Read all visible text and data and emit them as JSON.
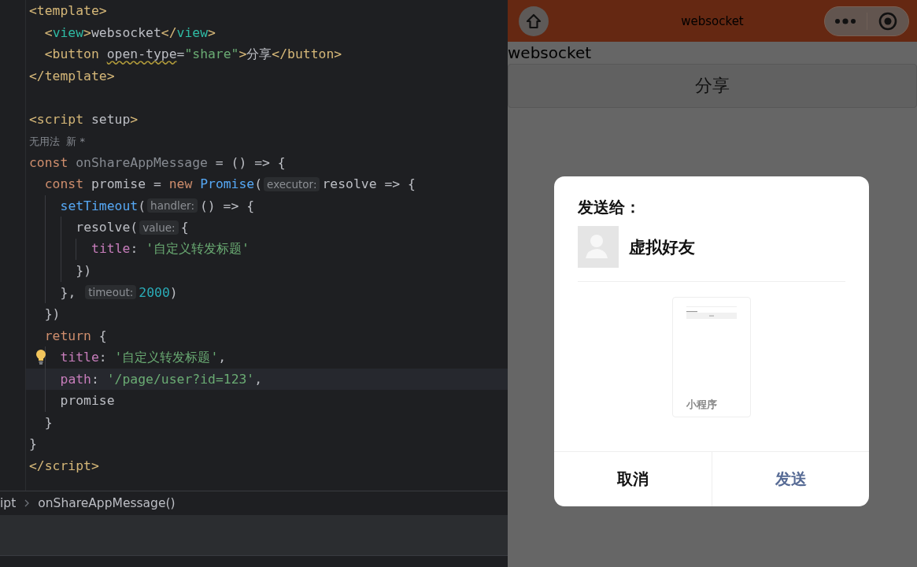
{
  "editor": {
    "lines": [
      {
        "current": false,
        "tokens": [
          {
            "kind": "tag",
            "text": "<template>"
          }
        ]
      },
      {
        "current": false,
        "tokens": [
          {
            "kind": "tag",
            "text": "  <"
          },
          {
            "kind": "tag2",
            "text": "view"
          },
          {
            "kind": "tag",
            "text": ">"
          },
          {
            "kind": "plain",
            "text": "websocket"
          },
          {
            "kind": "tag",
            "text": "</"
          },
          {
            "kind": "tag2",
            "text": "view"
          },
          {
            "kind": "tag",
            "text": ">"
          }
        ]
      },
      {
        "current": false,
        "tokens": [
          {
            "kind": "tag",
            "text": "  <button "
          },
          {
            "kind": "attr-warn",
            "text": "open-type"
          },
          {
            "kind": "plain",
            "text": "="
          },
          {
            "kind": "string",
            "text": "\"share\""
          },
          {
            "kind": "tag",
            "text": ">"
          },
          {
            "kind": "plain",
            "text": "分享"
          },
          {
            "kind": "tag",
            "text": "</button>"
          }
        ]
      },
      {
        "current": false,
        "tokens": [
          {
            "kind": "tag",
            "text": "</template>"
          }
        ]
      },
      {
        "current": false
      },
      {
        "current": false,
        "tokens": [
          {
            "kind": "tag",
            "text": "<script "
          },
          {
            "kind": "plain",
            "text": "setup"
          },
          {
            "kind": "tag",
            "text": ">"
          }
        ]
      },
      {
        "current": false,
        "tokens": [
          {
            "kind": "usage",
            "text": "无用法  新 *"
          }
        ]
      },
      {
        "current": false,
        "tokens": [
          {
            "kind": "keyword",
            "text": "const "
          },
          {
            "kind": "unused",
            "text": "onShareAppMessage"
          },
          {
            "kind": "plain",
            "text": " = () => {"
          }
        ]
      },
      {
        "current": false,
        "tokens": [
          {
            "kind": "keyword",
            "text": "  const "
          },
          {
            "kind": "plain",
            "text": "promise = "
          },
          {
            "kind": "keyword",
            "text": "new "
          },
          {
            "kind": "fn",
            "text": "Promise"
          },
          {
            "kind": "plain",
            "text": "("
          },
          {
            "kind": "hint",
            "text": "executor:"
          },
          {
            "kind": "plain",
            "text": "resolve => {"
          }
        ]
      },
      {
        "current": false,
        "tokens": [
          {
            "kind": "fn",
            "text": "    setTimeout"
          },
          {
            "kind": "plain",
            "text": "("
          },
          {
            "kind": "hint",
            "text": "handler:"
          },
          {
            "kind": "plain",
            "text": "() => {"
          }
        ]
      },
      {
        "current": false,
        "tokens": [
          {
            "kind": "plain",
            "text": "      resolve("
          },
          {
            "kind": "hint",
            "text": "value:"
          },
          {
            "kind": "plain",
            "text": "{"
          }
        ]
      },
      {
        "current": false,
        "tokens": [
          {
            "kind": "prop",
            "text": "        title"
          },
          {
            "kind": "plain",
            "text": ": "
          },
          {
            "kind": "string",
            "text": "'自定义转发标题'"
          }
        ]
      },
      {
        "current": false,
        "tokens": [
          {
            "kind": "plain",
            "text": "      })"
          }
        ]
      },
      {
        "current": false,
        "tokens": [
          {
            "kind": "plain",
            "text": "    }, "
          },
          {
            "kind": "hint",
            "text": "timeout:"
          },
          {
            "kind": "number",
            "text": "2000"
          },
          {
            "kind": "plain",
            "text": ")"
          }
        ]
      },
      {
        "current": false,
        "tokens": [
          {
            "kind": "plain",
            "text": "  })"
          }
        ]
      },
      {
        "current": false,
        "tokens": [
          {
            "kind": "keyword",
            "text": "  return "
          },
          {
            "kind": "plain",
            "text": "{"
          }
        ]
      },
      {
        "current": false,
        "bulb": true,
        "tokens": [
          {
            "kind": "prop",
            "text": "    title"
          },
          {
            "kind": "plain",
            "text": ": "
          },
          {
            "kind": "string",
            "text": "'自定义转发标题'"
          },
          {
            "kind": "plain",
            "text": ","
          }
        ]
      },
      {
        "current": true,
        "tokens": [
          {
            "kind": "prop",
            "text": "    path"
          },
          {
            "kind": "plain",
            "text": ": "
          },
          {
            "kind": "string",
            "text": "'/page/user?id=123'"
          },
          {
            "kind": "plain",
            "text": ","
          }
        ]
      },
      {
        "current": false,
        "tokens": [
          {
            "kind": "plain",
            "text": "    promise"
          }
        ]
      },
      {
        "current": false,
        "tokens": [
          {
            "kind": "plain",
            "text": "  }"
          }
        ]
      },
      {
        "current": false,
        "tokens": [
          {
            "kind": "plain",
            "text": "}"
          }
        ]
      },
      {
        "current": false,
        "tokens": [
          {
            "kind": "tag",
            "text": "</script>"
          }
        ]
      }
    ]
  },
  "breadcrumb": [
    "ipt",
    "onShareAppMessage()"
  ],
  "simulator": {
    "nav_title": "websocket",
    "page_text": "websocket",
    "share_button": "分享",
    "dialog": {
      "title": "发送给：",
      "friend": "虚拟好友",
      "card_label": "小程序",
      "buttons": [
        {
          "label": "取消",
          "kind": "cancel"
        },
        {
          "label": "发送",
          "kind": "primary"
        }
      ]
    }
  }
}
